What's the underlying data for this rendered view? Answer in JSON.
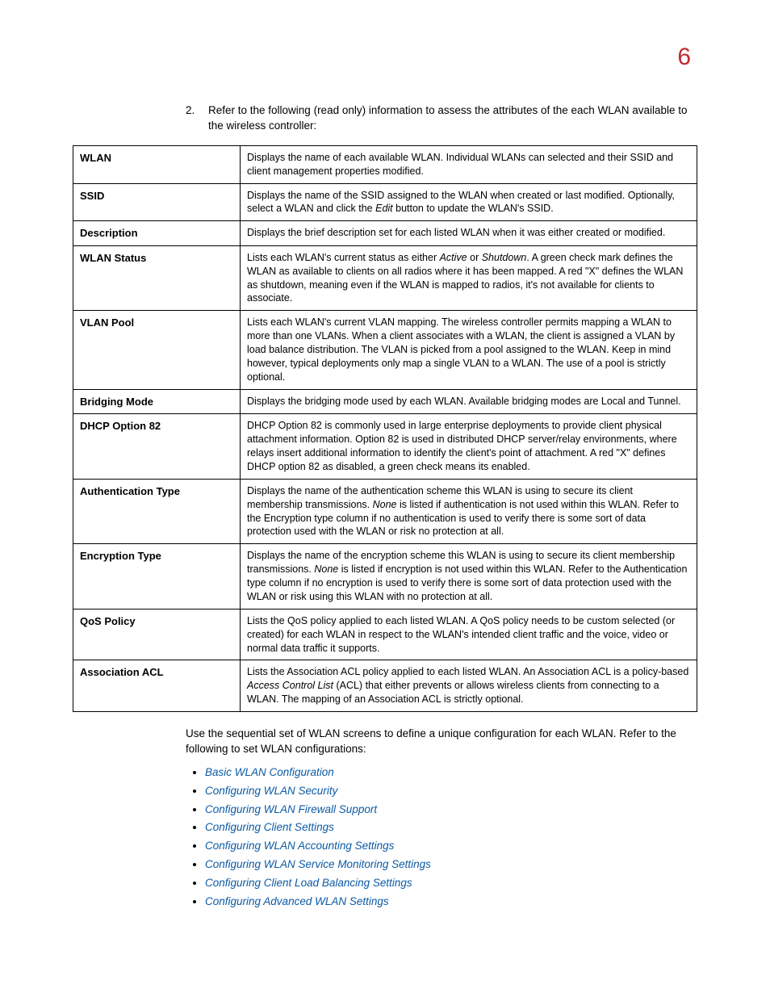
{
  "page_number": "6",
  "intro_num": "2.",
  "intro_text": "Refer to the following (read only) information to assess the attributes of the each WLAN available to the wireless controller:",
  "rows": [
    {
      "term": "WLAN",
      "desc": "Displays the name of each available WLAN. Individual WLANs can selected and their SSID and client management properties modified."
    },
    {
      "term": "SSID",
      "desc": "Displays the name of the SSID assigned to the WLAN when created or last modified. Optionally, select a WLAN and click the <em>Edit</em> button to update the WLAN's SSID."
    },
    {
      "term": "Description",
      "desc": "Displays the brief description set for each listed WLAN when it was either created or modified."
    },
    {
      "term": "WLAN Status",
      "desc": "Lists each WLAN's current status as either <em>Active</em> or <em>Shutdown</em>. A green check mark defines the WLAN as available to clients on all radios where it has been mapped. A red \"X\" defines the WLAN as shutdown, meaning even if the WLAN is mapped to radios, it's not available for clients to associate."
    },
    {
      "term": "VLAN Pool",
      "desc": "Lists each WLAN's current VLAN mapping. The wireless controller permits mapping a WLAN to more than one VLANs. When a client associates with a WLAN, the client is assigned a VLAN by load balance distribution. The VLAN is picked from a pool assigned to the WLAN. Keep in mind however, typical deployments only map a single VLAN to a WLAN. The use of a pool is strictly optional."
    },
    {
      "term": "Bridging Mode",
      "desc": "Displays the bridging mode used by each WLAN. Available bridging modes are Local and Tunnel."
    },
    {
      "term": "DHCP Option 82",
      "desc": "DHCP Option 82 is commonly used in large enterprise deployments to provide client physical attachment information. Option 82 is used in distributed DHCP server/relay environments, where relays insert additional information to identify the client's point of attachment. A red \"X\" defines DHCP option 82 as disabled, a green check means its enabled."
    },
    {
      "term": "Authentication Type",
      "desc": "Displays the name of the authentication scheme this WLAN is using to secure its client membership transmissions. <em>None</em> is listed if authentication is not used within this WLAN. Refer to the Encryption type column if no authentication is used to verify there is some sort of data protection used with the WLAN or risk no protection at all."
    },
    {
      "term": "Encryption Type",
      "desc": "Displays the name of the encryption scheme this WLAN is using to secure its client membership transmissions. <em>None</em> is listed if encryption is not used within this WLAN. Refer to the Authentication type column if no encryption is used to verify there is some sort of data protection used with the WLAN or risk using this WLAN with no protection at all."
    },
    {
      "term": "QoS Policy",
      "desc": "Lists the QoS policy applied to each listed WLAN. A QoS policy needs to be custom selected (or created) for each WLAN in respect to the WLAN's intended client traffic and the voice, video or normal data traffic it supports."
    },
    {
      "term": "Association ACL",
      "desc": "Lists the Association ACL policy applied to each listed WLAN. An Association ACL is a policy-based <em>Access Control List</em> (ACL) that either prevents or allows wireless clients from connecting to a WLAN. The mapping of an Association ACL is strictly optional."
    }
  ],
  "after_table": "Use the sequential set of WLAN screens to define a unique configuration for each WLAN. Refer to the following to set WLAN configurations:",
  "links": [
    "Basic WLAN Configuration",
    "Configuring WLAN Security",
    "Configuring WLAN Firewall Support",
    "Configuring Client Settings",
    "Configuring WLAN Accounting Settings",
    "Configuring WLAN Service Monitoring Settings",
    "Configuring Client Load Balancing Settings",
    "Configuring Advanced WLAN Settings"
  ]
}
